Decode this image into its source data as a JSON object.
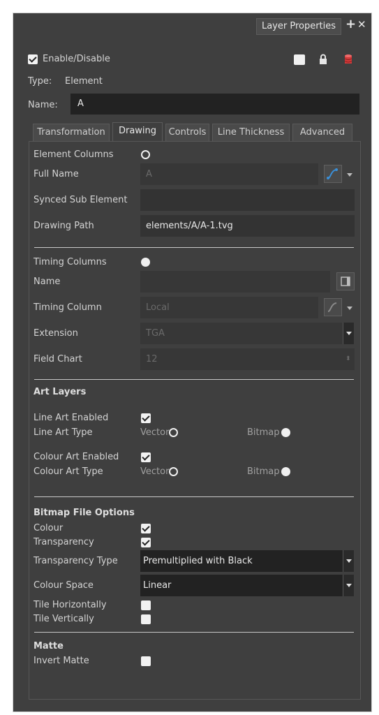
{
  "window": {
    "title": "Layer Properties"
  },
  "header": {
    "enable_label": "Enable/Disable",
    "type_label": "Type:",
    "type_value": "Element",
    "name_label": "Name:",
    "name_value": "A"
  },
  "tabs": [
    {
      "label": "Transformation"
    },
    {
      "label": "Drawing"
    },
    {
      "label": "Controls"
    },
    {
      "label": "Line Thickness"
    },
    {
      "label": "Advanced"
    }
  ],
  "element": {
    "columns_label": "Element Columns",
    "full_name_label": "Full Name",
    "full_name_value": "A",
    "synced_label": "Synced Sub Element",
    "synced_value": "",
    "path_label": "Drawing Path",
    "path_value": "elements/A/A-1.tvg"
  },
  "timing": {
    "columns_label": "Timing Columns",
    "name_label": "Name",
    "name_value": "",
    "column_label": "Timing Column",
    "column_value": "Local",
    "extension_label": "Extension",
    "extension_value": "TGA",
    "field_chart_label": "Field Chart",
    "field_chart_value": "12"
  },
  "art_layers": {
    "title": "Art Layers",
    "line_enabled_label": "Line Art Enabled",
    "line_type_label": "Line Art Type",
    "colour_enabled_label": "Colour Art Enabled",
    "colour_type_label": "Colour Art Type",
    "vector_label": "Vector",
    "bitmap_label": "Bitmap"
  },
  "bitmap": {
    "title": "Bitmap File Options",
    "colour_label": "Colour",
    "transparency_label": "Transparency",
    "transparency_type_label": "Transparency Type",
    "transparency_type_value": "Premultiplied with Black",
    "colour_space_label": "Colour Space",
    "colour_space_value": "Linear",
    "tile_h_label": "Tile Horizontally",
    "tile_v_label": "Tile Vertically"
  },
  "matte": {
    "title": "Matte",
    "invert_label": "Invert Matte"
  },
  "colors": {
    "panel_bg": "#3f3f3f",
    "field_bg": "#333333",
    "field_dark": "#222222",
    "accent_blue": "#3a8fd8",
    "accent_red": "#d23b3b"
  },
  "icons": {
    "add": "plus-icon",
    "close": "close-icon",
    "lock": "lock-icon",
    "color": "color-swatch-icon",
    "db": "database-icon",
    "function": "function-curve-icon"
  }
}
